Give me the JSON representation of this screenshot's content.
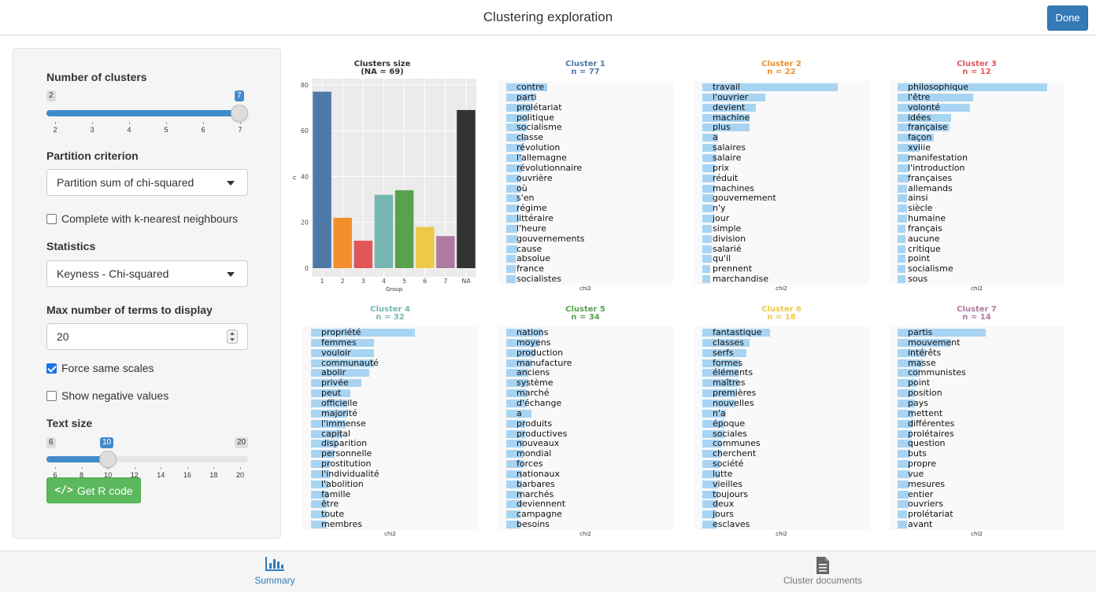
{
  "header": {
    "title": "Clustering exploration",
    "done_label": "Done"
  },
  "sidebar": {
    "clusters_label": "Number of clusters",
    "clusters_min": "2",
    "clusters_value": "7",
    "clusters_ticks": [
      "2",
      "3",
      "4",
      "5",
      "6",
      "7"
    ],
    "partition_label": "Partition criterion",
    "partition_value": "Partition sum of chi-squared",
    "knn_label": "Complete with k-nearest neighbours",
    "knn_checked": false,
    "statistics_label": "Statistics",
    "statistics_value": "Keyness - Chi-squared",
    "maxterms_label": "Max number of terms to display",
    "maxterms_value": "20",
    "samescales_label": "Force same scales",
    "samescales_checked": true,
    "negative_label": "Show negative values",
    "negative_checked": false,
    "textsize_label": "Text size",
    "textsize_min": "6",
    "textsize_value": "10",
    "textsize_max": "20",
    "textsize_ticks": [
      "6",
      "8",
      "10",
      "12",
      "14",
      "16",
      "18",
      "20"
    ],
    "rcode_label": "Get R code"
  },
  "colors": {
    "c1": "#4e79a7",
    "c2": "#f28e2b",
    "c3": "#e15759",
    "c4": "#76b7b2",
    "c5": "#59a14f",
    "c6": "#edc948",
    "c7": "#b07aa1",
    "na": "#333333",
    "term_bar": "#a8d4f3",
    "accent": "#337ab7",
    "slider": "#428bca"
  },
  "chart_data": {
    "type": "bar",
    "title": "Clusters size",
    "subtitle": "(NA = 69)",
    "xlabel": "Group",
    "ylabel": "n",
    "categories": [
      "1",
      "2",
      "3",
      "4",
      "5",
      "6",
      "7",
      "NA"
    ],
    "values": [
      77,
      22,
      12,
      32,
      34,
      18,
      14,
      69
    ],
    "yticks": [
      "0",
      "20",
      "40",
      "60",
      "80"
    ],
    "ylim": [
      0,
      82
    ]
  },
  "clusters": [
    {
      "title": "Cluster 1",
      "n": "n = 77",
      "color": "#4e79a7",
      "xlabel": "chi2",
      "terms": [
        "contre",
        "parti",
        "prolétariat",
        "politique",
        "socialisme",
        "classe",
        "révolution",
        "l'allemagne",
        "révolutionnaire",
        "ouvrière",
        "où",
        "s'en",
        "régime",
        "littéraire",
        "l'heure",
        "gouvernements",
        "cause",
        "absolue",
        "france",
        "socialistes"
      ],
      "values": [
        0.26,
        0.18,
        0.16,
        0.14,
        0.13,
        0.12,
        0.11,
        0.1,
        0.1,
        0.09,
        0.09,
        0.08,
        0.08,
        0.08,
        0.07,
        0.07,
        0.07,
        0.06,
        0.06,
        0.06
      ]
    },
    {
      "title": "Cluster 2",
      "n": "n = 22",
      "color": "#f28e2b",
      "xlabel": "chi2",
      "terms": [
        "travail",
        "l'ouvrier",
        "devient",
        "machine",
        "plus",
        "a",
        "salaires",
        "salaire",
        "prix",
        "réduit",
        "machines",
        "gouvernement",
        "n'y",
        "jour",
        "simple",
        "division",
        "salarié",
        "qu'il",
        "prennent",
        "marchandise"
      ],
      "values": [
        0.86,
        0.4,
        0.34,
        0.3,
        0.3,
        0.1,
        0.09,
        0.09,
        0.08,
        0.08,
        0.08,
        0.07,
        0.07,
        0.07,
        0.06,
        0.06,
        0.06,
        0.06,
        0.05,
        0.05
      ]
    },
    {
      "title": "Cluster 3",
      "n": "n = 12",
      "color": "#e15759",
      "xlabel": "chi2",
      "terms": [
        "philosophique",
        "l'être",
        "volonté",
        "idées",
        "française",
        "façon",
        "xviiie",
        "manifestation",
        "l'introduction",
        "françaises",
        "allemands",
        "ainsi",
        "siècle",
        "humaine",
        "français",
        "aucune",
        "critique",
        "point",
        "socialisme",
        "sous"
      ],
      "values": [
        0.95,
        0.48,
        0.46,
        0.34,
        0.33,
        0.23,
        0.14,
        0.07,
        0.07,
        0.07,
        0.06,
        0.06,
        0.06,
        0.06,
        0.05,
        0.05,
        0.05,
        0.05,
        0.05,
        0.05
      ]
    },
    {
      "title": "Cluster 4",
      "n": "n = 32",
      "color": "#76b7b2",
      "xlabel": "chi2",
      "terms": [
        "propriété",
        "femmes",
        "vouloir",
        "communauté",
        "abolir",
        "privée",
        "peut",
        "officielle",
        "majorité",
        "l'immense",
        "capital",
        "disparition",
        "personnelle",
        "prostitution",
        "l'individualité",
        "l'abolition",
        "famille",
        "être",
        "toute",
        "membres"
      ],
      "values": [
        0.66,
        0.4,
        0.4,
        0.4,
        0.37,
        0.32,
        0.25,
        0.23,
        0.23,
        0.22,
        0.2,
        0.17,
        0.15,
        0.12,
        0.12,
        0.11,
        0.11,
        0.1,
        0.1,
        0.1
      ]
    },
    {
      "title": "Cluster 5",
      "n": "n = 34",
      "color": "#59a14f",
      "xlabel": "chi2",
      "terms": [
        "nations",
        "moyens",
        "production",
        "manufacture",
        "anciens",
        "système",
        "marché",
        "d'échange",
        "a",
        "produits",
        "productives",
        "nouveaux",
        "mondial",
        "forces",
        "nationaux",
        "barbares",
        "marchés",
        "deviennent",
        "campagne",
        "besoins"
      ],
      "values": [
        0.23,
        0.21,
        0.18,
        0.16,
        0.14,
        0.14,
        0.13,
        0.13,
        0.16,
        0.12,
        0.12,
        0.11,
        0.11,
        0.11,
        0.1,
        0.1,
        0.1,
        0.1,
        0.09,
        0.09
      ]
    },
    {
      "title": "Cluster 6",
      "n": "n = 18",
      "color": "#edc948",
      "xlabel": "chi2",
      "terms": [
        "fantastique",
        "classes",
        "serfs",
        "formes",
        "éléments",
        "maîtres",
        "premières",
        "nouvelles",
        "n'a",
        "époque",
        "sociales",
        "communes",
        "cherchent",
        "société",
        "lutte",
        "vieilles",
        "toujours",
        "deux",
        "jours",
        "esclaves"
      ],
      "values": [
        0.43,
        0.3,
        0.28,
        0.24,
        0.23,
        0.23,
        0.22,
        0.21,
        0.15,
        0.14,
        0.14,
        0.12,
        0.12,
        0.11,
        0.11,
        0.1,
        0.1,
        0.1,
        0.09,
        0.09
      ]
    },
    {
      "title": "Cluster 7",
      "n": "n = 14",
      "color": "#b07aa1",
      "xlabel": "chi2",
      "terms": [
        "partis",
        "mouvement",
        "intérêts",
        "masse",
        "communistes",
        "point",
        "position",
        "pays",
        "mettent",
        "différentes",
        "prolétaires",
        "question",
        "buts",
        "propre",
        "vue",
        "mesures",
        "entier",
        "ouvriers",
        "prolétariat",
        "avant"
      ],
      "values": [
        0.56,
        0.34,
        0.18,
        0.16,
        0.14,
        0.12,
        0.11,
        0.11,
        0.1,
        0.1,
        0.09,
        0.09,
        0.08,
        0.08,
        0.08,
        0.07,
        0.07,
        0.07,
        0.06,
        0.06
      ]
    }
  ],
  "tabs": [
    {
      "label": "Summary",
      "active": true
    },
    {
      "label": "Cluster documents",
      "active": false
    }
  ]
}
